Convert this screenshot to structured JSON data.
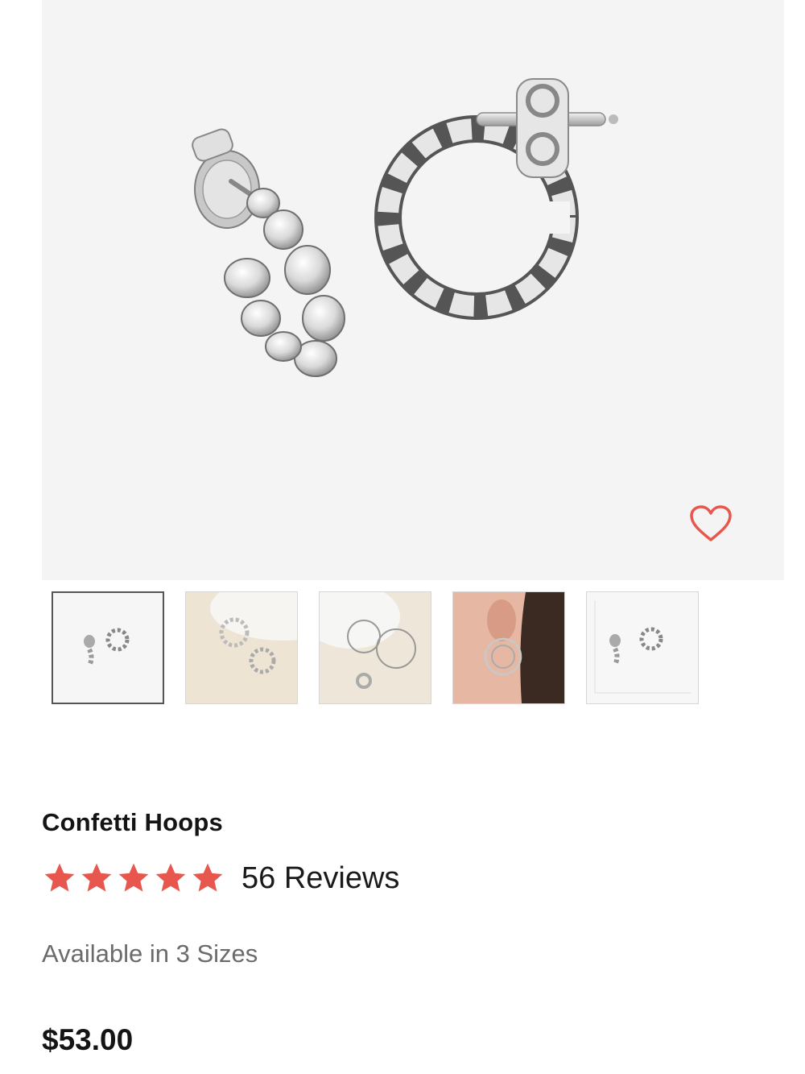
{
  "product": {
    "name": "Confetti Hoops",
    "rating": 5,
    "reviews_label": "56 Reviews",
    "availability": "Available in 3 Sizes",
    "price": "$53.00"
  },
  "gallery": {
    "thumbnails": [
      {
        "kind": "product-front",
        "selected": true
      },
      {
        "kind": "lifestyle-tray",
        "selected": false
      },
      {
        "kind": "lifestyle-set",
        "selected": false
      },
      {
        "kind": "model-ear",
        "selected": false
      },
      {
        "kind": "size-guide",
        "selected": false
      }
    ]
  },
  "colors": {
    "accent": "#e8574d",
    "hero_bg": "#f4f4f4",
    "muted_text": "#6b6b6b"
  },
  "icons": {
    "favorite": "heart-outline-icon",
    "rating": "star-icon"
  }
}
